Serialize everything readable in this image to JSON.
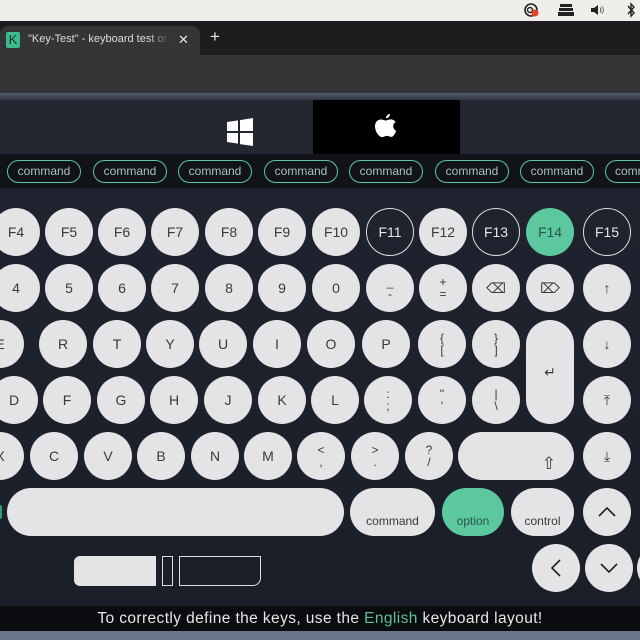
{
  "menubar": {
    "icons": [
      "screen-record-icon",
      "keyboard-layout-icon",
      "volume-icon",
      "bluetooth-icon"
    ]
  },
  "browser": {
    "tab": {
      "favicon_letter": "K",
      "title": "\"Key-Test\" - keyboard test online",
      "close": "✕"
    },
    "new_tab": "+"
  },
  "os_switch": {
    "options": [
      "windows",
      "apple"
    ],
    "selected": "apple"
  },
  "command_strip": {
    "labels": [
      "command",
      "command",
      "command",
      "command",
      "command",
      "command",
      "command",
      "command"
    ]
  },
  "keyboard": {
    "fn_row": [
      {
        "label": "F4",
        "state": "default"
      },
      {
        "label": "F5",
        "state": "default"
      },
      {
        "label": "F6",
        "state": "default"
      },
      {
        "label": "F7",
        "state": "default"
      },
      {
        "label": "F8",
        "state": "default"
      },
      {
        "label": "F9",
        "state": "default"
      },
      {
        "label": "F10",
        "state": "default"
      },
      {
        "label": "F11",
        "state": "outline"
      },
      {
        "label": "F12",
        "state": "default"
      },
      {
        "label": "F13",
        "state": "outline"
      },
      {
        "label": "F14",
        "state": "pressed"
      },
      {
        "label": "F15",
        "state": "outline"
      }
    ],
    "num_row": [
      {
        "label": "4"
      },
      {
        "label": "5"
      },
      {
        "label": "6"
      },
      {
        "label": "7"
      },
      {
        "label": "8"
      },
      {
        "label": "9"
      },
      {
        "label": "0"
      },
      {
        "hi": "_",
        "lo": "-"
      },
      {
        "hi": "+",
        "lo": "="
      },
      {
        "label": "⌫"
      },
      {
        "label": "⌦"
      },
      {
        "label": "↑"
      }
    ],
    "top_row": [
      {
        "label": "E"
      },
      {
        "label": "R"
      },
      {
        "label": "T"
      },
      {
        "label": "Y"
      },
      {
        "label": "U"
      },
      {
        "label": "I"
      },
      {
        "label": "O"
      },
      {
        "label": "P"
      },
      {
        "hi": "{",
        "lo": "["
      },
      {
        "hi": "}",
        "lo": "]"
      }
    ],
    "enter": "↵",
    "down_arrow": "↓",
    "home_row": [
      {
        "label": "D"
      },
      {
        "label": "F"
      },
      {
        "label": "G"
      },
      {
        "label": "H"
      },
      {
        "label": "J"
      },
      {
        "label": "K"
      },
      {
        "label": "L"
      },
      {
        "hi": ":",
        "lo": ";"
      },
      {
        "hi": "\"",
        "lo": "'"
      },
      {
        "hi": "|",
        "lo": "\\"
      }
    ],
    "page_up": "⤒",
    "bottom_row": [
      {
        "label": "X"
      },
      {
        "label": "C"
      },
      {
        "label": "V"
      },
      {
        "label": "B"
      },
      {
        "label": "N"
      },
      {
        "label": "M"
      },
      {
        "hi": "<",
        "lo": ","
      },
      {
        "hi": ">",
        "lo": "."
      },
      {
        "hi": "?",
        "lo": "/"
      }
    ],
    "shift": "⇧",
    "page_down": "⤓",
    "space_row": {
      "command": "command",
      "option": "option",
      "control": "control",
      "up": "︿"
    },
    "arrows": {
      "left": "‹",
      "down": "﹀"
    }
  },
  "hint": {
    "prefix": "To correctly define the keys, use the ",
    "accent": "English",
    "suffix": " keyboard layout!"
  },
  "colors": {
    "accent": "#5bc8a0",
    "key": "#e4e4e6",
    "background": "#1c2029"
  }
}
